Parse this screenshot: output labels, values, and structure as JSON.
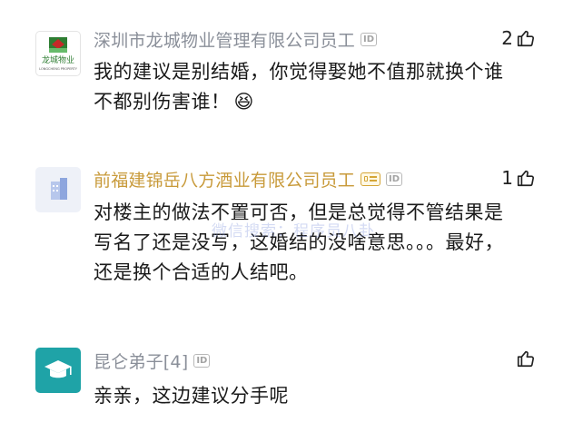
{
  "comments": [
    {
      "username": "深圳市龙城物业管理有限公司员工",
      "id_badge": "ID",
      "likes": "2",
      "text_lines": [
        "我的建议是别结婚，你觉得娶她不值那就换个谁",
        "不都别伤害谁！"
      ],
      "emoji": "😆",
      "avatar_logo_text": "龙城物业",
      "avatar_logo_subtext": "LONGCHENG PROPERTY"
    },
    {
      "username": "前福建锦岳八方酒业有限公司员工",
      "id_badge": "ID",
      "likes": "1",
      "text_lines": [
        "对楼主的做法不置可否，但是总觉得不管结果是",
        "写名了还是没写，这婚结的没啥意思。。。最好，",
        "还是换个合适的人结吧。"
      ]
    },
    {
      "username": "昆仑弟子[4]",
      "id_badge": "ID",
      "likes": "",
      "text_lines": [
        "亲亲，这边建议分手呢"
      ]
    }
  ],
  "watermark": "微信搜索：程序员八卦",
  "colors": {
    "accent_gold": "#c89a3a",
    "username_gray": "#8a8f99",
    "avatar_teal": "#1fa3a7"
  }
}
